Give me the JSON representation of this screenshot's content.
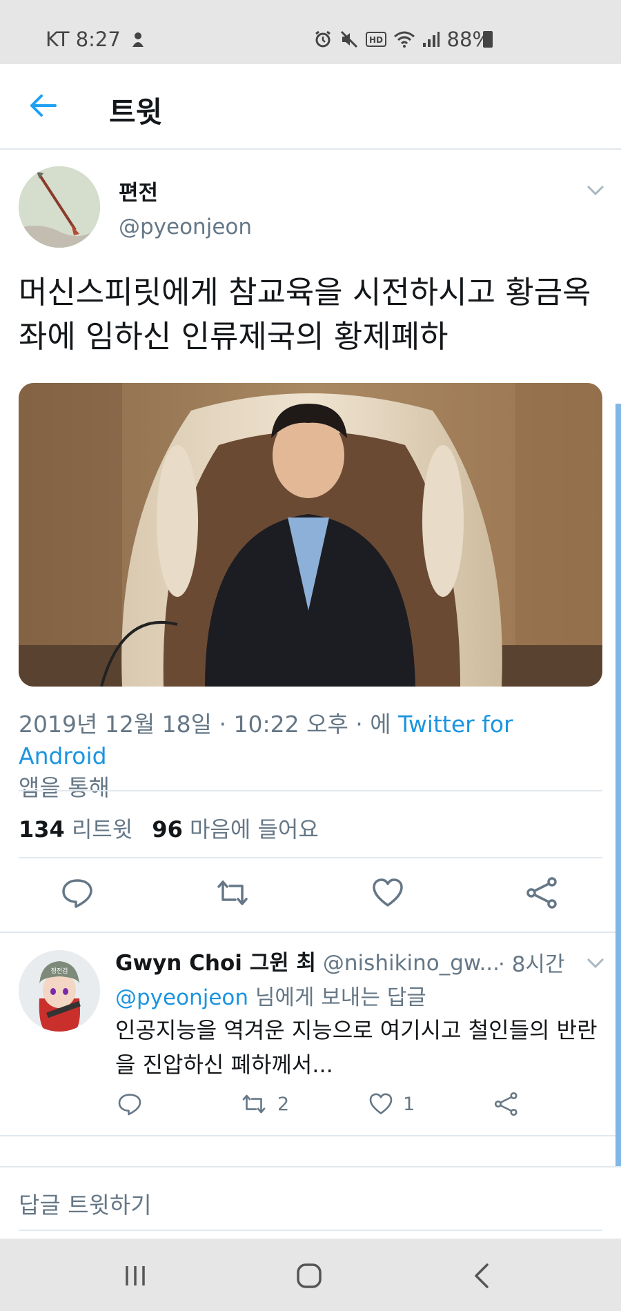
{
  "status_bar": {
    "carrier_time": "KT 8:27",
    "battery": "88%"
  },
  "header": {
    "title": "트윗"
  },
  "tweet": {
    "display_name": "편전",
    "handle": "@pyeonjeon",
    "text": "머신스피릿에게 참교육을 시전하시고 황금옥좌에 임하신 인류제국의 황제폐하",
    "meta_prefix": "2019년 12월 18일 · 10:22 오후 · 에 ",
    "meta_source": "Twitter for Android",
    "meta_suffix": "앱을 통해",
    "retweet_count": "134",
    "retweet_label": "리트윗",
    "like_count": "96",
    "like_label": "마음에 들어요"
  },
  "reply": {
    "name": "Gwyn Choi 그윈 최",
    "handle": "@nishikino_gw...",
    "time": "· 8시간",
    "reply_to_handle": "@pyeonjeon",
    "reply_to_suffix": " 님에게 보내는 답글",
    "text": "인공지능을 역겨운 지능으로 여기시고 철인들의 반란을 진압하신 폐하께서...",
    "retweets": "2",
    "likes": "1",
    "avatar_badge": "정전검"
  },
  "compose": {
    "placeholder": "답글 트윗하기"
  },
  "colors": {
    "accent": "#1b95e0",
    "muted": "#657786",
    "text": "#14171a"
  }
}
